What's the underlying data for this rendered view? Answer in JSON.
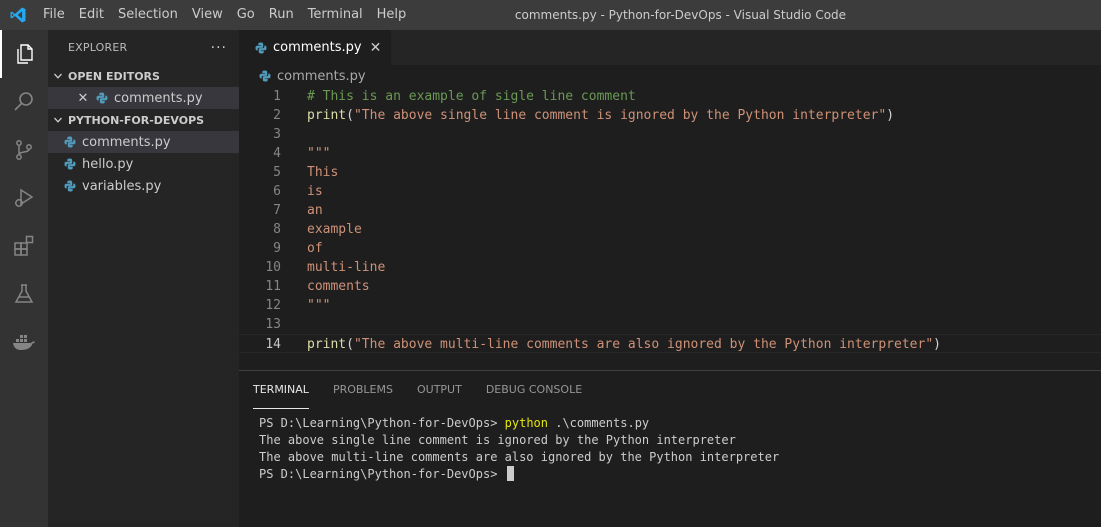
{
  "titlebar": {
    "menu": [
      "File",
      "Edit",
      "Selection",
      "View",
      "Go",
      "Run",
      "Terminal",
      "Help"
    ],
    "window_title": "comments.py - Python-for-DevOps - Visual Studio Code"
  },
  "activity_bar": {
    "icons": [
      "explorer-icon",
      "search-icon",
      "source-control-icon",
      "run-debug-icon",
      "extensions-icon",
      "testing-icon",
      "docker-icon"
    ]
  },
  "sidebar": {
    "title": "EXPLORER",
    "more": "···",
    "open_editors": {
      "title": "OPEN EDITORS",
      "items": [
        {
          "label": "comments.py"
        }
      ]
    },
    "folder": {
      "title": "PYTHON-FOR-DEVOPS",
      "files": [
        {
          "label": "comments.py"
        },
        {
          "label": "hello.py"
        },
        {
          "label": "variables.py"
        }
      ]
    }
  },
  "editor": {
    "tab": {
      "label": "comments.py",
      "close": "✕"
    },
    "breadcrumb": "comments.py",
    "lines": [
      {
        "num": "1",
        "segments": [
          {
            "t": "# This is an example of sigle line comment",
            "c": "c-comment"
          }
        ]
      },
      {
        "num": "2",
        "segments": [
          {
            "t": "print",
            "c": "c-fn"
          },
          {
            "t": "(",
            "c": "c-punc"
          },
          {
            "t": "\"The above single line comment is ignored by the Python interpreter\"",
            "c": "c-str"
          },
          {
            "t": ")",
            "c": "c-punc"
          }
        ]
      },
      {
        "num": "3",
        "segments": []
      },
      {
        "num": "4",
        "segments": [
          {
            "t": "\"\"\"",
            "c": "c-str"
          }
        ]
      },
      {
        "num": "5",
        "segments": [
          {
            "t": "This",
            "c": "c-str"
          }
        ]
      },
      {
        "num": "6",
        "segments": [
          {
            "t": "is",
            "c": "c-str"
          }
        ]
      },
      {
        "num": "7",
        "segments": [
          {
            "t": "an",
            "c": "c-str"
          }
        ]
      },
      {
        "num": "8",
        "segments": [
          {
            "t": "example",
            "c": "c-str"
          }
        ]
      },
      {
        "num": "9",
        "segments": [
          {
            "t": "of",
            "c": "c-str"
          }
        ]
      },
      {
        "num": "10",
        "segments": [
          {
            "t": "multi-line",
            "c": "c-str"
          }
        ]
      },
      {
        "num": "11",
        "segments": [
          {
            "t": "comments",
            "c": "c-str"
          }
        ]
      },
      {
        "num": "12",
        "segments": [
          {
            "t": "\"\"\"",
            "c": "c-str"
          }
        ]
      },
      {
        "num": "13",
        "segments": []
      },
      {
        "num": "14",
        "current": true,
        "segments": [
          {
            "t": "print",
            "c": "c-fn"
          },
          {
            "t": "(",
            "c": "c-punc"
          },
          {
            "t": "\"The above multi-line comments are also ignored by the Python interpreter\"",
            "c": "c-str"
          },
          {
            "t": ")",
            "c": "c-punc"
          }
        ]
      }
    ]
  },
  "panel": {
    "tabs": [
      {
        "label": "TERMINAL",
        "active": true
      },
      {
        "label": "PROBLEMS"
      },
      {
        "label": "OUTPUT"
      },
      {
        "label": "DEBUG CONSOLE"
      }
    ],
    "terminal": {
      "prompt1": "PS D:\\Learning\\Python-for-DevOps> ",
      "command": "python",
      "args": " .\\comments.py",
      "output": [
        "The above single line comment is ignored by the Python interpreter",
        "The above multi-line comments are also ignored by the Python interpreter"
      ],
      "prompt2": "PS D:\\Learning\\Python-for-DevOps> "
    }
  },
  "colors": {
    "accent_blue": "#23a9f2",
    "python_blue": "#519aba",
    "terminal_command": "#e5e510"
  }
}
